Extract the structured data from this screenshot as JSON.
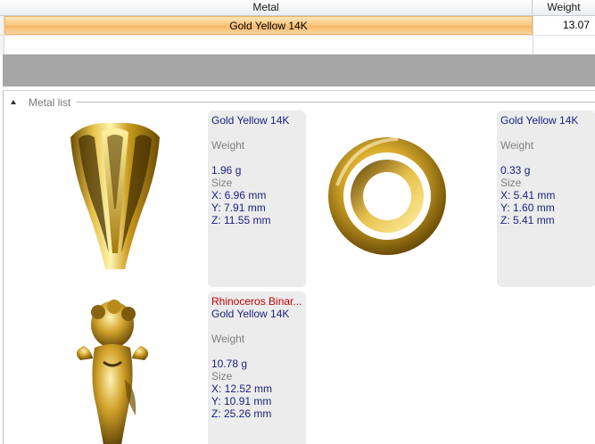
{
  "grid": {
    "columns": {
      "metal": "Metal",
      "weight": "Weight"
    },
    "rows": [
      {
        "metal": "Gold Yellow 14K",
        "weight": "13.07"
      }
    ]
  },
  "metal_list": {
    "title": "Metal list",
    "items": [
      {
        "image_icon": "flared-gold-bail-icon",
        "metal": "Gold Yellow 14K",
        "weight_label": "Weight",
        "weight": "1.96 g",
        "size_label": "Size",
        "x": "X: 6.96 mm",
        "y": "Y: 7.91 mm",
        "z": "Z: 11.55 mm"
      },
      {
        "image_icon": "gold-ring-icon",
        "metal": "Gold Yellow 14K",
        "weight_label": "Weight",
        "weight": "0.33 g",
        "size_label": "Size",
        "x": "X: 5.41 mm",
        "y": "Y: 1.60 mm",
        "z": "Z: 5.41 mm"
      },
      {
        "image_icon": "gold-cherub-icon",
        "warning": "Rhinoceros Binar...",
        "metal": "Gold Yellow 14K",
        "weight_label": "Weight",
        "weight": "10.78 g",
        "size_label": "Size",
        "x": "X: 12.52 mm",
        "y": "Y: 10.91 mm",
        "z": "Z: 25.26 mm"
      }
    ]
  },
  "colors": {
    "selection": "#fbc882",
    "value_text": "#1a237e",
    "warning_text": "#c00000",
    "band": "#a6a6a6",
    "card": "#ececec"
  }
}
